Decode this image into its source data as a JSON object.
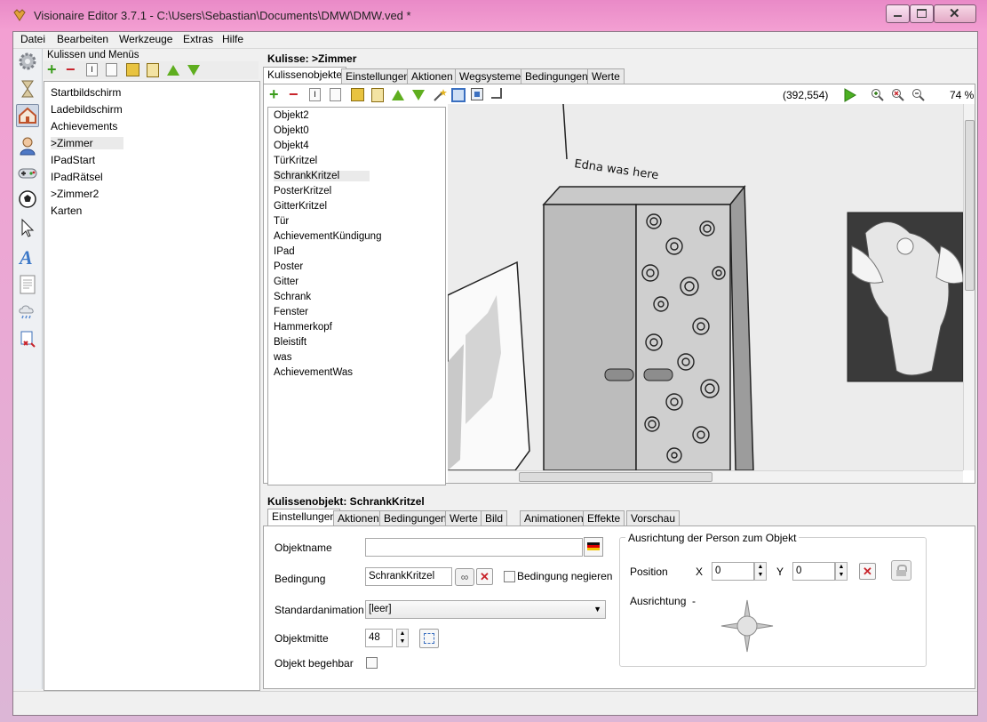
{
  "window": {
    "title": "Visionaire Editor 3.7.1 - C:\\Users\\Sebastian\\Documents\\DMW\\DMW.ved *",
    "controls": [
      "minimize-icon",
      "maximize-icon",
      "close-icon"
    ]
  },
  "menu": [
    "Datei",
    "Bearbeiten",
    "Werkzeuge",
    "Extras",
    "Hilfe"
  ],
  "sidebar_tools": [
    "gear-icon",
    "hourglass-icon",
    "house-icon",
    "person-icon",
    "gamepad-icon",
    "ball-icon",
    "cursor-icon",
    "font-icon",
    "text-icon",
    "weather-icon",
    "script-icon"
  ],
  "left_panel": {
    "label": "Kulissen und Menüs",
    "items": [
      "Startbildschirm",
      "Ladebildschirm",
      "Achievements",
      ">Zimmer",
      "IPadStart",
      "IPadRätsel",
      ">Zimmer2",
      "Karten"
    ],
    "selected": ">Zimmer"
  },
  "kulisse": {
    "title": "Kulisse: >Zimmer",
    "tabs": [
      "Kulissenobjekte",
      "Einstellungen",
      "Aktionen",
      "Wegsysteme",
      "Bedingungen",
      "Werte"
    ],
    "active_tab": "Kulissenobjekte",
    "coords": "(392,554)",
    "zoom": "74 %",
    "objects": [
      "Objekt2",
      "Objekt0",
      "Objekt4",
      "TürKritzel",
      "SchrankKritzel",
      "PosterKritzel",
      "GitterKritzel",
      "Tür",
      "AchievementKündigung",
      "IPad",
      "Poster",
      "Gitter",
      "Schrank",
      "Fenster",
      "Hammerkopf",
      "Bleistift",
      "was",
      "AchievementWas"
    ],
    "selected_object": "SchrankKritzel",
    "scene_text": "Edna was here"
  },
  "object_panel": {
    "title": "Kulissenobjekt: SchrankKritzel",
    "tabs": [
      "Einstellungen",
      "Aktionen",
      "Bedingungen",
      "Werte",
      "Bild",
      "Animationen",
      "Effekte",
      "Vorschau"
    ],
    "active_tab": "Einstellungen",
    "objektname_label": "Objektname",
    "objektname_value": "",
    "bedingung_label": "Bedingung",
    "bedingung_value": "SchrankKritzel",
    "negieren_label": "Bedingung negieren",
    "standardanimation_label": "Standardanimation",
    "standardanimation_value": "[leer]",
    "objektmitte_label": "Objektmitte",
    "objektmitte_value": "48",
    "begehbar_label": "Objekt begehbar",
    "ausrichtung_group": "Ausrichtung der Person zum Objekt",
    "position_label": "Position",
    "x_label": "X",
    "x_value": "0",
    "y_label": "Y",
    "y_value": "0",
    "ausrichtung_label": "Ausrichtung",
    "ausrichtung_value": "-"
  }
}
